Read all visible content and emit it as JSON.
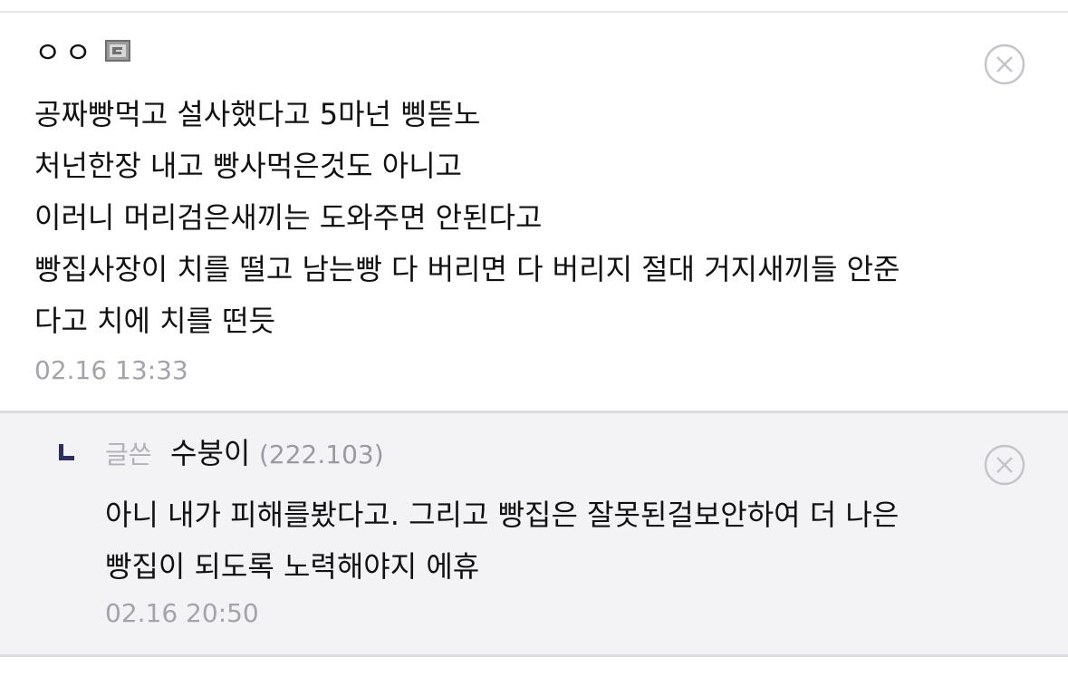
{
  "comment": {
    "nickname": "ㅇㅇ",
    "badge_icon": "fixed-nick-icon",
    "lines": [
      "공짜빵먹고 설사했다고 5마넌 삥뜯노",
      "처넌한장 내고 빵사먹은것도 아니고",
      "이러니 머리검은새끼는 도와주면 안된다고",
      "빵집사장이 치를 떨고 남는빵 다 버리면 다 버리지 절대 거지새끼들 안준",
      "다고 치에 치를 떤듯"
    ],
    "date": "02.16 13:33",
    "close_icon": "close-circle-icon"
  },
  "reply": {
    "author_tag": "글쓴",
    "author_name": "수붕이",
    "author_ip": "(222.103)",
    "lines": [
      "아니 내가 피해를봤다고. 그리고 빵집은 잘못된걸보안하여 더 나은",
      "빵집이 되도록 노력해야지 에휴"
    ],
    "date": "02.16 20:50",
    "close_icon": "close-circle-icon"
  },
  "colors": {
    "text": "#111111",
    "muted": "#a3a3ab",
    "reply_bg": "#f3f3f6",
    "divider": "#dcdce2"
  }
}
